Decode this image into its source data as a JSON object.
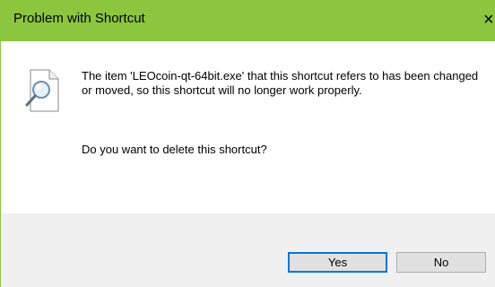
{
  "dialog": {
    "title": "Problem with Shortcut",
    "close_glyph": "×",
    "message": "The item 'LEOcoin-qt-64bit.exe' that this shortcut refers to has been changed or moved, so this shortcut will no longer work properly.",
    "question": "Do you want to delete this shortcut?",
    "icon": "shortcut-document-magnifier-icon"
  },
  "buttons": {
    "yes_label": "Yes",
    "no_label": "No"
  },
  "colors": {
    "titlebar": "#8cc63f",
    "footer": "#f0f0f0",
    "default_button_border": "#0078d7"
  }
}
